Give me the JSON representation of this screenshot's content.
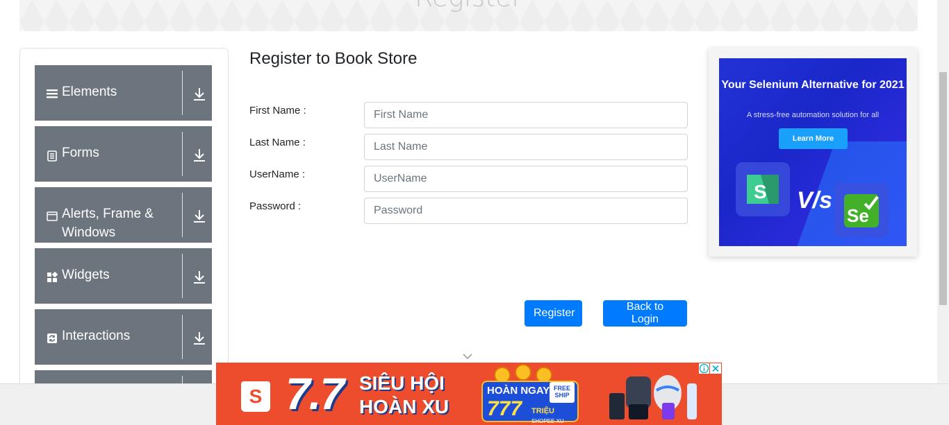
{
  "header": {
    "title": "Register"
  },
  "sidebar": {
    "groups": [
      {
        "label": "Elements",
        "icon": "hamburger-icon"
      },
      {
        "label": "Forms",
        "icon": "document-icon"
      },
      {
        "label": "Alerts, Frame & Windows",
        "icon": "window-icon"
      },
      {
        "label": "Widgets",
        "icon": "widgets-icon"
      },
      {
        "label": "Interactions",
        "icon": "refresh-icon"
      }
    ]
  },
  "main": {
    "title": "Register to Book Store",
    "fields": [
      {
        "label": "First Name :",
        "placeholder": "First Name",
        "value": ""
      },
      {
        "label": "Last Name :",
        "placeholder": "Last Name",
        "value": ""
      },
      {
        "label": "UserName :",
        "placeholder": "UserName",
        "value": ""
      },
      {
        "label": "Password :",
        "placeholder": "Password",
        "value": ""
      }
    ],
    "register_label": "Register",
    "back_label": "Back to Login"
  },
  "side_ad": {
    "headline": "Your Selenium Alternative for 2021",
    "subtext": "A stress-free automation solution for all",
    "cta": "Learn More",
    "vs": "V/s",
    "logo_left": "S",
    "logo_right": "Se"
  },
  "bottom_ad": {
    "big": "7.7",
    "line1": "SIÊU HỘI",
    "line2": "HOÀN XU",
    "coin_line1": "HOÀN NGAY",
    "coin_amount": "777",
    "coin_unit": "TRIỆU",
    "coin_sub": "SHOPEE XU",
    "free_ship": "FREE SHIP",
    "brand_letter": "S"
  },
  "colors": {
    "nav_bg": "#6c757d",
    "primary": "#007bff",
    "shopee": "#ee4d2d",
    "ad_blue": "#2233d6"
  }
}
